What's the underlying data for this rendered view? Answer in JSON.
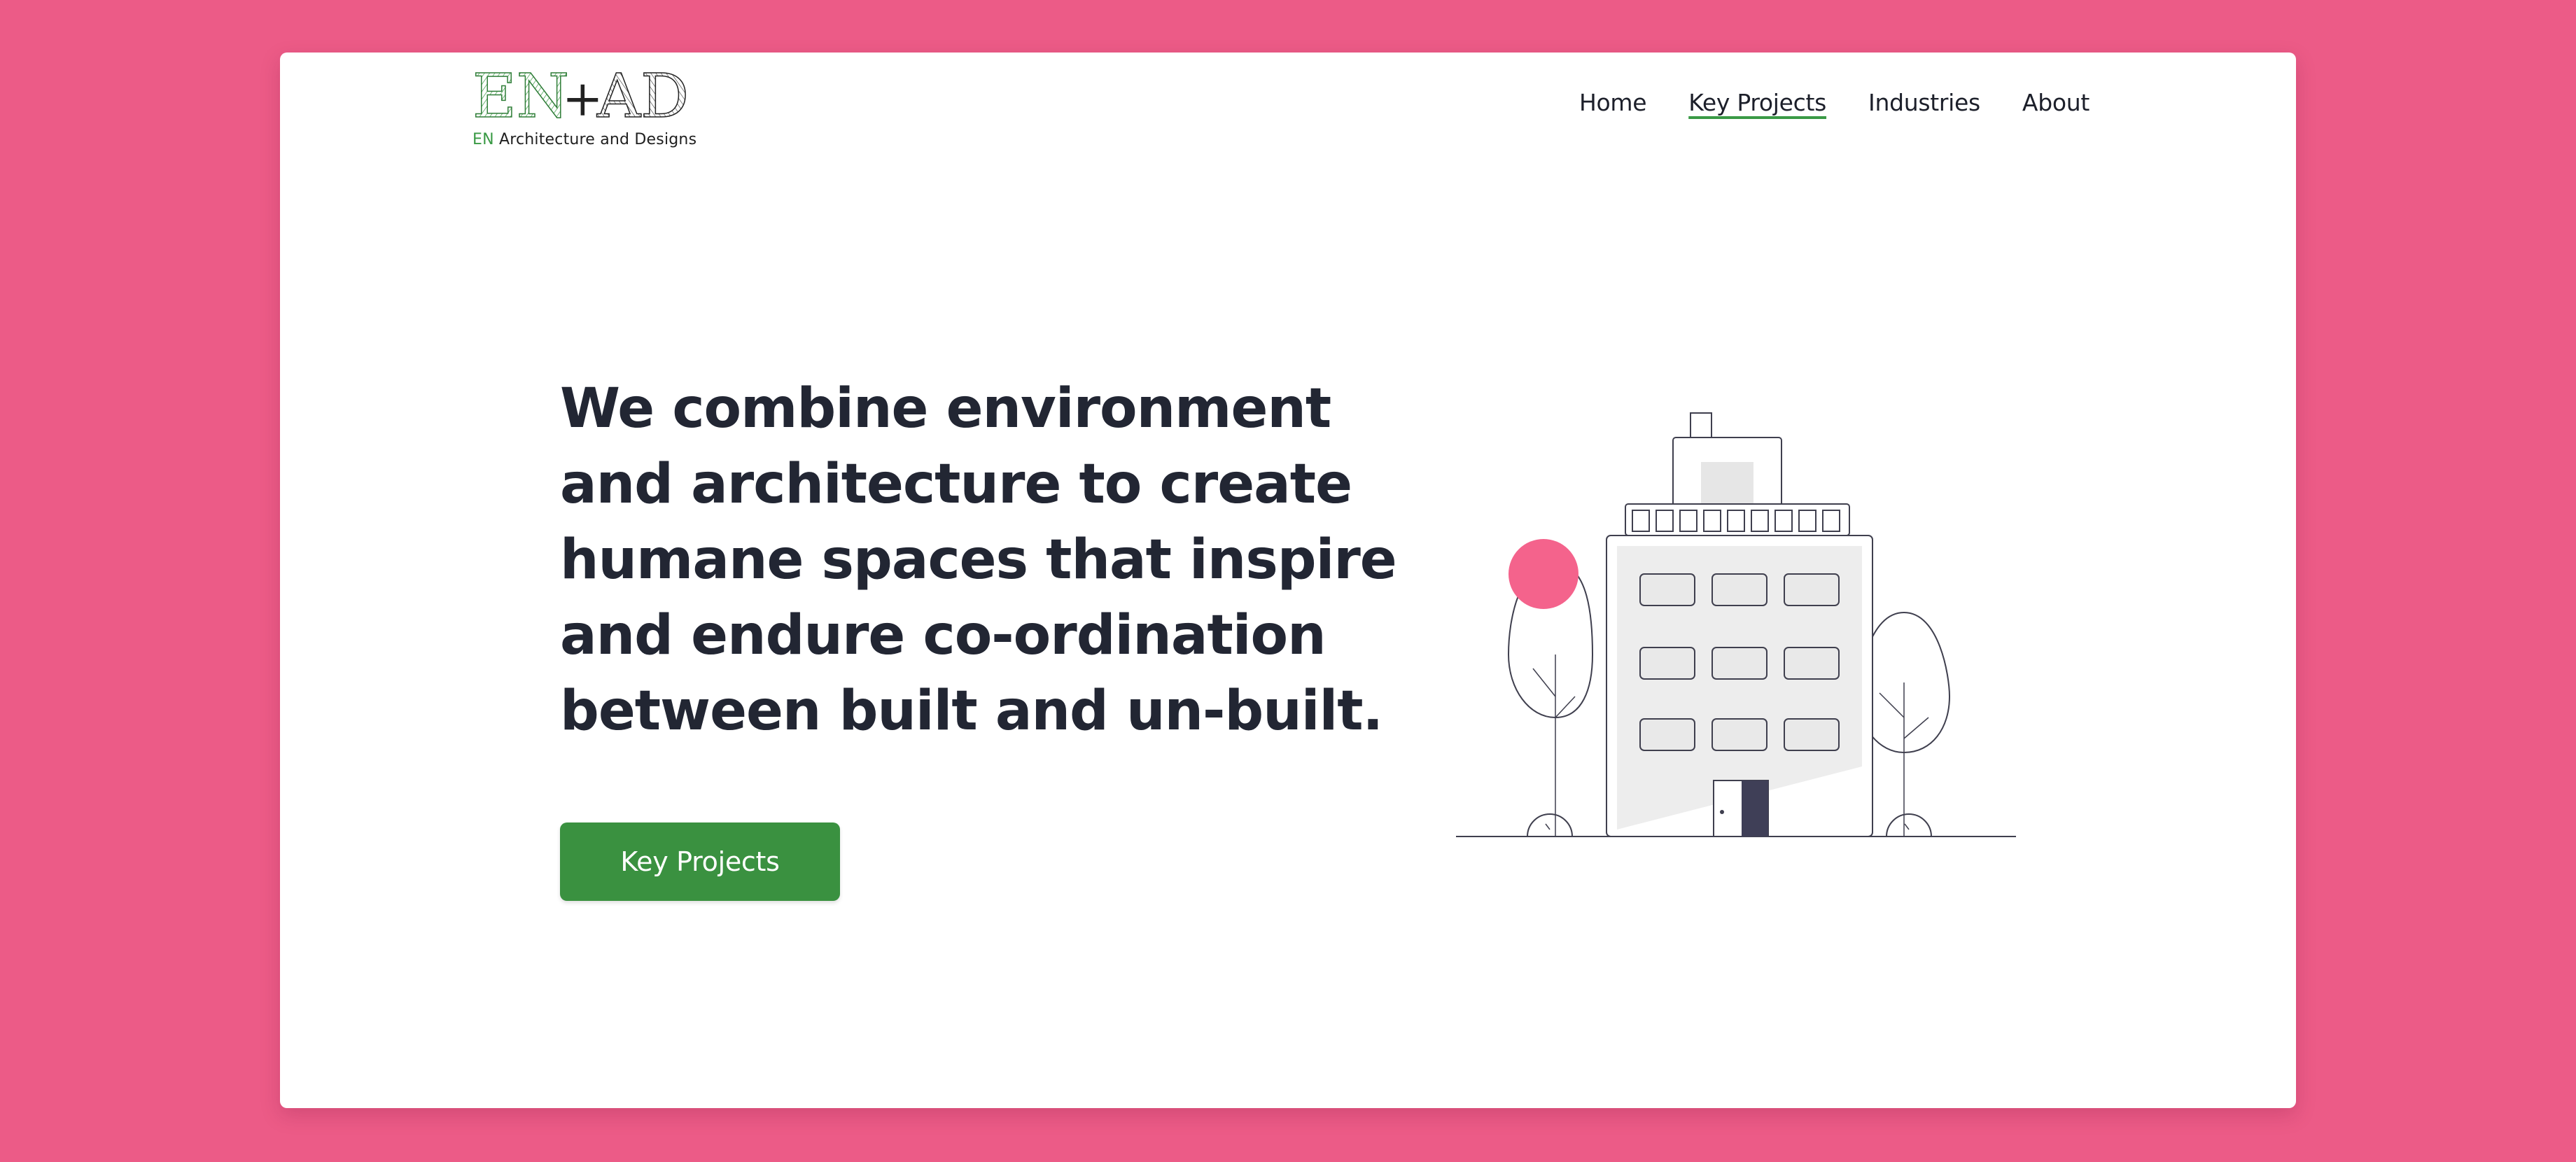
{
  "logo": {
    "mark_text": "EN+AD",
    "sub_prefix": "EN",
    "sub_text": " Architecture and Designs"
  },
  "nav": {
    "items": [
      {
        "label": "Home"
      },
      {
        "label": "Key Projects",
        "active": true
      },
      {
        "label": "Industries"
      },
      {
        "label": "About"
      }
    ]
  },
  "hero": {
    "headline": "We combine environment and architecture to create humane spaces that inspire and endure co-ordination between built and un-built.",
    "cta_label": "Key Projects"
  },
  "icons": {
    "illustration": "building-illustration-icon"
  },
  "colors": {
    "background": "#ec5b87",
    "accent_green": "#3a9140",
    "headline": "#222633",
    "illustration_accent": "#f4638c"
  }
}
